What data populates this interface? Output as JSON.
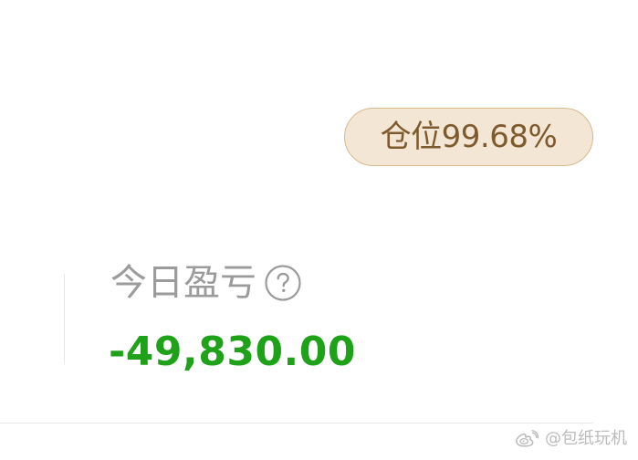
{
  "position": {
    "label": "仓位99.68%"
  },
  "today_pnl": {
    "label": "今日盈亏",
    "value": "-49,830.00"
  },
  "watermark": {
    "text": "@包纸玩机"
  },
  "icons": {
    "help": "question-circle-icon",
    "weibo": "weibo-logo"
  },
  "colors": {
    "badge_background": "#F3E6D5",
    "badge_border": "#D7B98C",
    "badge_text": "#7E5B2E",
    "label_text": "#9B9B9B",
    "loss_text": "#1FA11A",
    "divider": "#E7E7E7",
    "watermark_text": "#B4B4B4"
  }
}
